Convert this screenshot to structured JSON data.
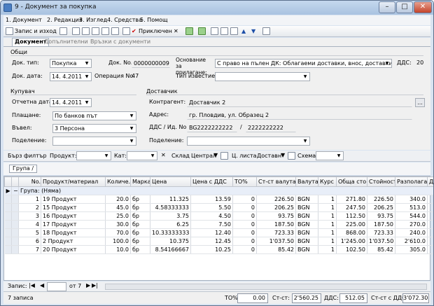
{
  "window": {
    "title": "9 - Документ за покупка"
  },
  "menu": [
    "1. Документ",
    "2. Редакция",
    "3. Изглед",
    "4. Средства",
    "5. Помощ"
  ],
  "toolbar": {
    "save_close": "Запис и изход",
    "posted": "Приключен"
  },
  "tabs": [
    "Документ",
    "Допълнителни",
    "Връзки с документи"
  ],
  "general": {
    "section": "Общи",
    "doc_type_label": "Док. тип:",
    "doc_type": "Покупка",
    "doc_no_label": "Док. No.",
    "doc_no": "0000000009",
    "basis_label": "Основание за прилагане:",
    "basis": "С право на пълен ДК: Облагаеми доставки, внос, доставки по чл.65",
    "vat_label": "ДДС:",
    "vat": "20",
    "doc_date_label": "Док. дата:",
    "doc_date": "14. 4.2011",
    "op_no_label": "Операция No.",
    "op_no": "47",
    "notice_label": "Тип известие:",
    "notice": ""
  },
  "buyer": {
    "section": "Купувач",
    "report_date_label": "Отчетна дата:",
    "report_date": "14. 4.2011",
    "payment_label": "Плащане:",
    "payment": "По банков път",
    "entered_label": "Въвел:",
    "entered": "3 Персона",
    "division_label": "Поделение:",
    "division": ""
  },
  "supplier": {
    "section": "Доставчик",
    "contractor_label": "Контрагент:",
    "contractor": "Доставчик 2",
    "address_label": "Адрес:",
    "address": "гр. Пловдив, ул. Образец 2",
    "vat_id_label": "ДДС / Ид. No.",
    "vat_no": "BG2222222222",
    "id_no": "2222222222",
    "division_label": "Поделение:",
    "division": ""
  },
  "filter": {
    "quick": "Бърз филтър",
    "product": "Продукт:",
    "cat": "Кат:",
    "warehouse": "Склад",
    "warehouse_value": "Централ",
    "price_list": "Ц. листа",
    "price_list_value": "Доставн",
    "scheme": "Схема"
  },
  "group_chip": "Група",
  "columns": [
    "No.",
    "Продукт/материал",
    "Количе...",
    "Марка",
    "Цена",
    "Цена с ДДС",
    "ТО%",
    "Ст-ст валута",
    "Валута",
    "Курс",
    "Обща сто...",
    "Стойност",
    "Разполагае...",
    "ДД"
  ],
  "group_row": "Група: (Няма)",
  "rows": [
    [
      "1",
      "19 Продукт",
      "20.0",
      "бр",
      "11.325",
      "13.59",
      "0",
      "226.50",
      "BGN",
      "1",
      "271.80",
      "226.50",
      "340.0"
    ],
    [
      "2",
      "15 Продукт",
      "45.0",
      "бр",
      "4.58333333",
      "5.50",
      "0",
      "206.25",
      "BGN",
      "1",
      "247.50",
      "206.25",
      "513.0"
    ],
    [
      "3",
      "16 Продукт",
      "25.0",
      "бр",
      "3.75",
      "4.50",
      "0",
      "93.75",
      "BGN",
      "1",
      "112.50",
      "93.75",
      "544.0"
    ],
    [
      "4",
      "17 Продукт",
      "30.0",
      "бр",
      "6.25",
      "7.50",
      "0",
      "187.50",
      "BGN",
      "1",
      "225.00",
      "187.50",
      "270.0"
    ],
    [
      "5",
      "18 Продукт",
      "70.0",
      "бр",
      "10.33333333",
      "12.40",
      "0",
      "723.33",
      "BGN",
      "1",
      "868.00",
      "723.33",
      "240.0"
    ],
    [
      "6",
      "2 Продукт",
      "100.0",
      "бр",
      "10.375",
      "12.45",
      "0",
      "1'037.50",
      "BGN",
      "1",
      "1'245.00",
      "1'037.50",
      "2'610.0"
    ],
    [
      "7",
      "20 Продукт",
      "10.0",
      "бр",
      "8.54166667",
      "10.25",
      "0",
      "85.42",
      "BGN",
      "1",
      "102.50",
      "85.42",
      "305.0"
    ]
  ],
  "nav": {
    "record_label": "Запис:",
    "of": "от 7"
  },
  "footer": {
    "count": "7 записа",
    "to_label": "ТО%:",
    "to": "0.00",
    "cost_label": "Ст-ст:",
    "cost": "2'560.25",
    "vat_label": "ДДС:",
    "vat": "512.05",
    "total_label": "Ст-ст с ДДС:",
    "total": "3'072.30"
  }
}
